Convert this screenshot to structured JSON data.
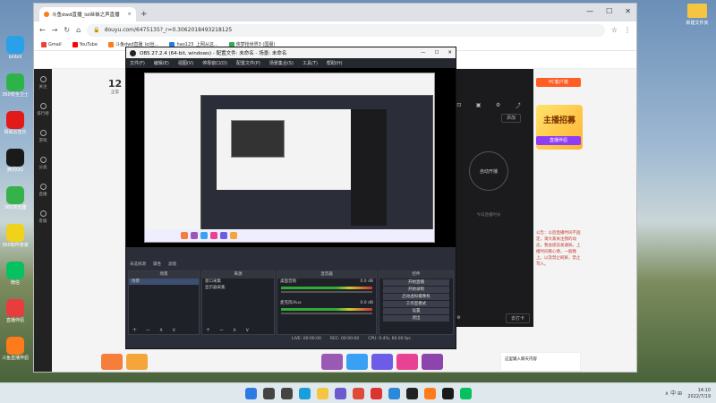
{
  "desktop": {
    "icons": [
      {
        "label": "bilibili",
        "color": "#2aa0e8"
      },
      {
        "label": "360安全卫士",
        "color": "#2db34a"
      },
      {
        "label": "网易云音乐",
        "color": "#e21a1a"
      },
      {
        "label": "腾讯QQ",
        "color": "#1a1a1a"
      },
      {
        "label": "360浏览器",
        "color": "#36b24a"
      },
      {
        "label": "360软件管家",
        "color": "#f0d21a"
      },
      {
        "label": "微信",
        "color": "#07c160"
      },
      {
        "label": "直播伴侣",
        "color": "#e93d3d"
      },
      {
        "label": "斗鱼直播伴侣",
        "color": "#ff7a1a"
      }
    ],
    "folder_label": "新建文件夹"
  },
  "browser": {
    "tab_title": "斗鱼dwd直播_lol丝袜之声直播",
    "tab_close": "×",
    "new_tab": "+",
    "window_controls": [
      "—",
      "☐",
      "✕"
    ],
    "nav": {
      "back": "←",
      "forward": "→",
      "reload": "↻",
      "home": "⌂"
    },
    "url": "douyu.com/6475135?_r=0.3062018493218125",
    "bookmarks": [
      {
        "label": "Gmail",
        "color": "#ea4335"
      },
      {
        "label": "YouTube",
        "color": "#ff0000"
      },
      {
        "label": "斗鱼dwd直播_lol丝...",
        "color": "#ff7a1a"
      },
      {
        "label": "hao123_上网从这...",
        "color": "#2a7ae2"
      },
      {
        "label": "侠梦抢世界3 (国服)",
        "color": "#34a853"
      }
    ]
  },
  "site": {
    "sidebar": [
      "关注",
      "排行榜",
      "游戏",
      "分类",
      "直播",
      "客服"
    ],
    "counter_num": "12",
    "counter_label": "正常",
    "right_circle": "自动开播",
    "right_add": "添加",
    "right_hint": "今日直播时长",
    "right_bottom_btn": "去打卡",
    "promo_top": "PC客户端",
    "promo_big": "主播招募",
    "promo_purple": "直播伴侣",
    "announcement": "公告：以后直播时间不固定，请大家关注我的动态，我会提前发通知。上播时间看心情，一般晚上。以及禁止刷屏，禁止骂人。",
    "chat_placeholder": "这里输入聊天内容"
  },
  "obs": {
    "title": "OBS 27.2.4 (64-bit, windows) - 配置文件: 未命名 - 场景: 未命名",
    "menu": [
      "文件(F)",
      "编辑(E)",
      "视图(V)",
      "停靠窗口(D)",
      "配置文件(P)",
      "场景集合(S)",
      "工具(T)",
      "帮助(H)"
    ],
    "dock_header": [
      "未选择源",
      "属性",
      "滤镜"
    ],
    "panes": {
      "scenes": {
        "title": "场景",
        "items": [
          "场景"
        ]
      },
      "sources": {
        "title": "来源",
        "items": [
          "窗口采集",
          "显示器采集"
        ]
      },
      "mixer": {
        "title": "混音器",
        "items": [
          "桌面音频",
          "麦克风/Aux"
        ],
        "levels": [
          "0.0 dB",
          "0.0 dB"
        ]
      },
      "controls": {
        "title": "控件",
        "items": [
          "开始直播",
          "开始录制",
          "启动虚拟摄像机",
          "工作室模式",
          "设置",
          "退出"
        ]
      }
    },
    "status": {
      "live": "LIVE: 00:00:00",
      "rec": "REC: 00:00:00",
      "cpu": "CPU: 0.4%, 60.00 fps"
    },
    "footer_symbols": "+ − ∧ ∨"
  },
  "taskbar": {
    "icons": [
      {
        "name": "start",
        "color": "#2c7be5"
      },
      {
        "name": "search",
        "color": "#444"
      },
      {
        "name": "task-view",
        "color": "#444"
      },
      {
        "name": "edge",
        "color": "#1a9ed9"
      },
      {
        "name": "explorer",
        "color": "#f5c542"
      },
      {
        "name": "store",
        "color": "#6a5acd"
      },
      {
        "name": "chrome",
        "color": "#e04a3a"
      },
      {
        "name": "wps",
        "color": "#d33"
      },
      {
        "name": "photos",
        "color": "#2a8ad9"
      },
      {
        "name": "obs",
        "color": "#222"
      },
      {
        "name": "douyu",
        "color": "#ff7a1a"
      },
      {
        "name": "qq",
        "color": "#1a1a1a"
      },
      {
        "name": "wechat",
        "color": "#07c160"
      }
    ],
    "tray": "∧  中  ⊞",
    "time": "14:10",
    "date": "2022/7/19"
  }
}
